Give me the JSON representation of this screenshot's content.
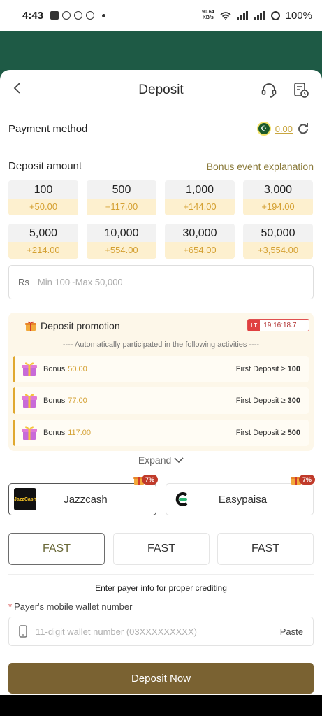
{
  "status_bar": {
    "time": "4:43",
    "net_speed_top": "90.64",
    "net_speed_unit": "KB/s",
    "battery": "100%"
  },
  "header": {
    "title": "Deposit"
  },
  "payment_method": {
    "label": "Payment method",
    "balance": "0.00"
  },
  "deposit_amount": {
    "label": "Deposit amount",
    "bonus_link": "Bonus event explanation",
    "options": [
      {
        "amount": "100",
        "bonus": "+50.00"
      },
      {
        "amount": "500",
        "bonus": "+117.00"
      },
      {
        "amount": "1,000",
        "bonus": "+144.00"
      },
      {
        "amount": "3,000",
        "bonus": "+194.00"
      },
      {
        "amount": "5,000",
        "bonus": "+214.00"
      },
      {
        "amount": "10,000",
        "bonus": "+554.00"
      },
      {
        "amount": "30,000",
        "bonus": "+654.00"
      },
      {
        "amount": "50,000",
        "bonus": "+3,554.00"
      }
    ],
    "currency": "Rs",
    "placeholder": "Min 100~Max 50,000"
  },
  "promotion": {
    "title": "Deposit promotion",
    "timer_tag": "LT",
    "timer": "19:16:18.7",
    "subtitle": "---- Automatically participated in the following activities ----",
    "rows": [
      {
        "label": "Bonus",
        "value": "50.00",
        "condition": "First Deposit ≥",
        "threshold": "100"
      },
      {
        "label": "Bonus",
        "value": "77.00",
        "condition": "First Deposit ≥",
        "threshold": "300"
      },
      {
        "label": "Bonus",
        "value": "117.00",
        "condition": "First Deposit ≥",
        "threshold": "500"
      }
    ],
    "expand": "Expand"
  },
  "methods": [
    {
      "name": "Jazzcash",
      "badge": "7%",
      "logo_text": "JazzCash"
    },
    {
      "name": "Easypaisa",
      "badge": "7%"
    }
  ],
  "channels": [
    "FAST",
    "FAST",
    "FAST"
  ],
  "payer": {
    "note": "Enter payer info for proper crediting",
    "label": "Payer's mobile wallet number",
    "placeholder": "11-digit wallet number (03XXXXXXXXX)",
    "paste": "Paste"
  },
  "submit": "Deposit Now",
  "colors": {
    "accent_brown": "#7a6232",
    "bonus_gold": "#d4a032",
    "header_green": "#1e5a45",
    "badge_red": "#c03a2a"
  }
}
